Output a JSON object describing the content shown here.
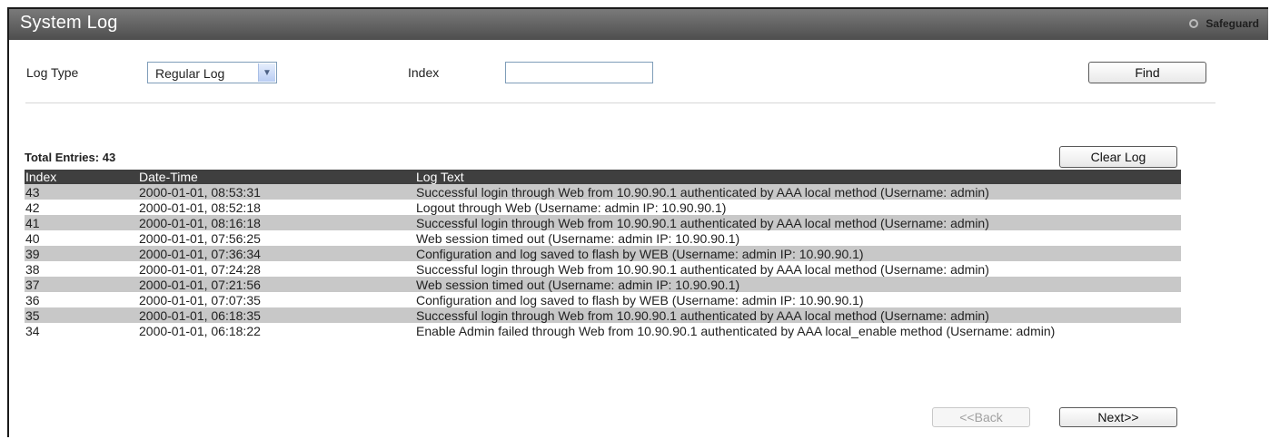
{
  "header": {
    "title": "System Log",
    "safeguard_label": "Safeguard"
  },
  "filter": {
    "log_type_label": "Log Type",
    "log_type_value": "Regular Log",
    "index_label": "Index",
    "index_value": "",
    "find_label": "Find"
  },
  "summary": {
    "total_entries": "Total Entries: 43",
    "clear_label": "Clear Log"
  },
  "table": {
    "columns": [
      "Index",
      "Date-Time",
      "Log Text"
    ],
    "rows": [
      [
        "43",
        "2000-01-01, 08:53:31",
        "Successful login through Web from 10.90.90.1 authenticated by AAA local method (Username: admin)"
      ],
      [
        "42",
        "2000-01-01, 08:52:18",
        "Logout through Web (Username: admin IP: 10.90.90.1)"
      ],
      [
        "41",
        "2000-01-01, 08:16:18",
        "Successful login through Web from 10.90.90.1 authenticated by AAA local method (Username: admin)"
      ],
      [
        "40",
        "2000-01-01, 07:56:25",
        "Web session timed out (Username: admin IP: 10.90.90.1)"
      ],
      [
        "39",
        "2000-01-01, 07:36:34",
        "Configuration and log saved to flash by WEB (Username: admin IP: 10.90.90.1)"
      ],
      [
        "38",
        "2000-01-01, 07:24:28",
        "Successful login through Web from 10.90.90.1 authenticated by AAA local method (Username: admin)"
      ],
      [
        "37",
        "2000-01-01, 07:21:56",
        "Web session timed out (Username: admin IP: 10.90.90.1)"
      ],
      [
        "36",
        "2000-01-01, 07:07:35",
        "Configuration and log saved to flash by WEB (Username: admin IP: 10.90.90.1)"
      ],
      [
        "35",
        "2000-01-01, 06:18:35",
        "Successful login through Web from 10.90.90.1 authenticated by AAA local method (Username: admin)"
      ],
      [
        "34",
        "2000-01-01, 06:18:22",
        "Enable Admin failed through Web from 10.90.90.1 authenticated by AAA local_enable method (Username: admin)"
      ]
    ]
  },
  "pager": {
    "back_label": "<<Back",
    "next_label": "Next>>"
  },
  "icons": {
    "safeguard": "circle-icon",
    "dropdown": "chevron-down-icon"
  }
}
